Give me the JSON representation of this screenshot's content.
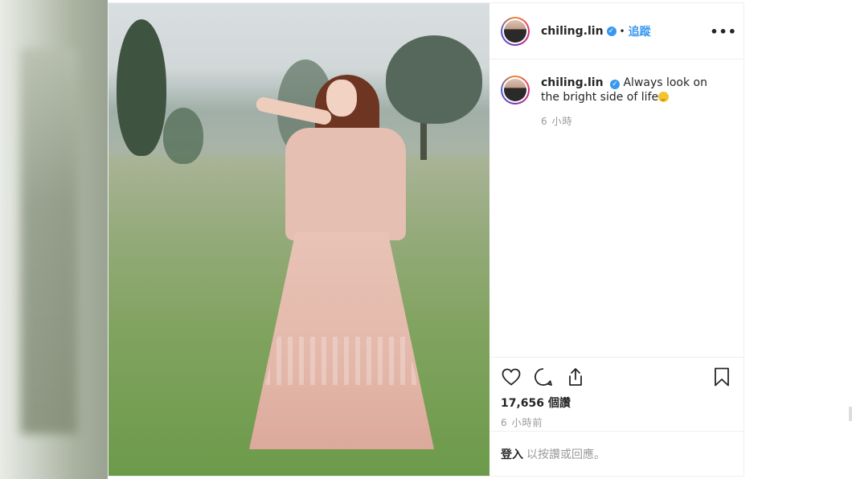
{
  "post": {
    "username": "chiling.lin",
    "follow_label": "追蹤",
    "more_label": "•••",
    "caption_text": "Always look on the bright side of life",
    "caption_time": "6 小時",
    "likes": "17,656 個讚",
    "post_time": "6 小時前",
    "login_link": "登入",
    "login_rest": "以按讚或回應。"
  },
  "icons": {
    "verified": "verified-badge-icon",
    "like": "heart-icon",
    "comment": "comment-bubble-icon",
    "share": "share-upload-icon",
    "save": "bookmark-icon",
    "emoji": "smiling-face-emoji"
  },
  "colors": {
    "link_blue": "#3897f0",
    "text": "#262626",
    "muted": "#999999",
    "border": "#efefef"
  }
}
